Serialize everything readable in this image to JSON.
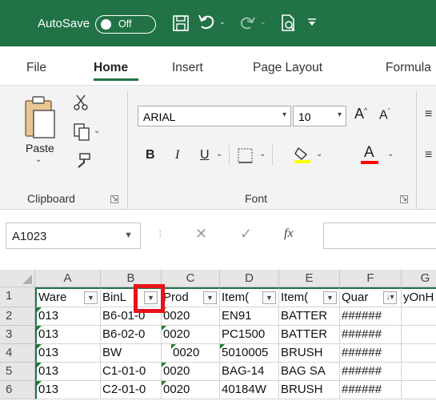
{
  "titlebar": {
    "autosave_label": "AutoSave",
    "autosave_state": "Off",
    "bg_color": "#217346",
    "icons": [
      "save-icon",
      "undo-icon",
      "redo-icon",
      "print-preview-icon",
      "customize-qat-icon"
    ]
  },
  "ribbon": {
    "tabs": [
      "File",
      "Home",
      "Insert",
      "Page Layout",
      "Formula"
    ],
    "active_tab": "Home",
    "clipboard": {
      "group_label": "Clipboard",
      "paste_label": "Paste"
    },
    "font": {
      "group_label": "Font",
      "font_name": "ARIAL",
      "font_size": "10",
      "bold": "B",
      "italic": "I",
      "underline": "U",
      "font_color_letter": "A",
      "fill_color": "#ffff00",
      "font_color": "#ff0000"
    }
  },
  "formula_bar": {
    "name_box": "A1023",
    "fx_label": "fx",
    "value": ""
  },
  "sheet": {
    "columns": [
      "A",
      "B",
      "C",
      "D",
      "E",
      "F",
      "G"
    ],
    "header_row": [
      "Ware",
      "BinL",
      "Prod",
      "Item(",
      "Item(",
      "Quar",
      "yOnH"
    ],
    "rows": [
      {
        "num": "1"
      },
      {
        "num": "2",
        "cells": [
          "013",
          "B6-01-0",
          "0020",
          "EN91",
          "BATTER",
          "######"
        ]
      },
      {
        "num": "3",
        "cells": [
          "013",
          "B6-02-0",
          "0020",
          "PC1500",
          "BATTER",
          "######"
        ]
      },
      {
        "num": "4",
        "cells": [
          "013",
          "BW",
          "0020",
          "5010005",
          "BRUSH",
          "######"
        ]
      },
      {
        "num": "5",
        "cells": [
          "013",
          "C1-01-0",
          "0020",
          "BAG-14",
          "BAG SA",
          "######"
        ]
      },
      {
        "num": "6",
        "cells": [
          "013",
          "C2-01-0",
          "0020",
          "40184W",
          "BRUSH",
          "######"
        ]
      }
    ],
    "highlighted_filter": "B1"
  }
}
